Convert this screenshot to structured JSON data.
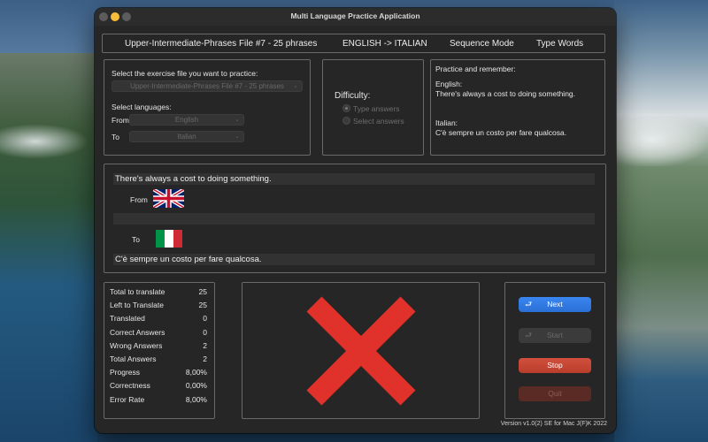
{
  "window": {
    "title": "Multi Language Practice Application"
  },
  "header": {
    "file": "Upper-Intermediate-Phrases File #7 - 25 phrases",
    "direction": "ENGLISH -> ITALIAN",
    "mode": "Sequence Mode",
    "type": "Type Words"
  },
  "selection": {
    "file_prompt": "Select the exercise file you want to practice:",
    "file_value": "Upper-Intermediate-Phrases File #7 - 25 phrases",
    "languages_label": "Select languages:",
    "from_label": "From",
    "from_value": "English",
    "to_label": "To",
    "to_value": "Italian"
  },
  "difficulty": {
    "label": "Difficulty:",
    "options": [
      "Type answers",
      "Select answers"
    ],
    "selected": "Type answers"
  },
  "practice": {
    "heading": "Practice and remember:",
    "source_lang": "English:",
    "source_text": "There's always a cost to doing something.",
    "target_lang": "Italian:",
    "target_text": "C'è sempre un costo per fare qualcosa."
  },
  "exercise": {
    "source_phrase": "There's always a cost to doing something.",
    "from_label": "From",
    "to_label": "To",
    "answer_input": "",
    "target_phrase": "C'è sempre un costo per fare qualcosa.",
    "from_flag": "uk-flag",
    "to_flag": "italy-flag"
  },
  "stats": [
    {
      "label": "Total to translate",
      "value": "25"
    },
    {
      "label": "Left to Translate",
      "value": "25"
    },
    {
      "label": "Translated",
      "value": "0"
    },
    {
      "label": "Correct Answers",
      "value": "0"
    },
    {
      "label": "Wrong Answers",
      "value": "2"
    },
    {
      "label": "Total Answers",
      "value": "2"
    },
    {
      "label": "Progress",
      "value": "8,00%"
    },
    {
      "label": "Correctness",
      "value": "0,00%"
    },
    {
      "label": "Error Rate",
      "value": "8,00%"
    }
  ],
  "result": {
    "icon": "red-x-icon",
    "color": "#e0322a"
  },
  "controls": {
    "next": "Next",
    "start": "Start",
    "stop": "Stop",
    "quit": "Quit"
  },
  "version": "Version v1.0(2) SE for Mac J(F)K 2022"
}
